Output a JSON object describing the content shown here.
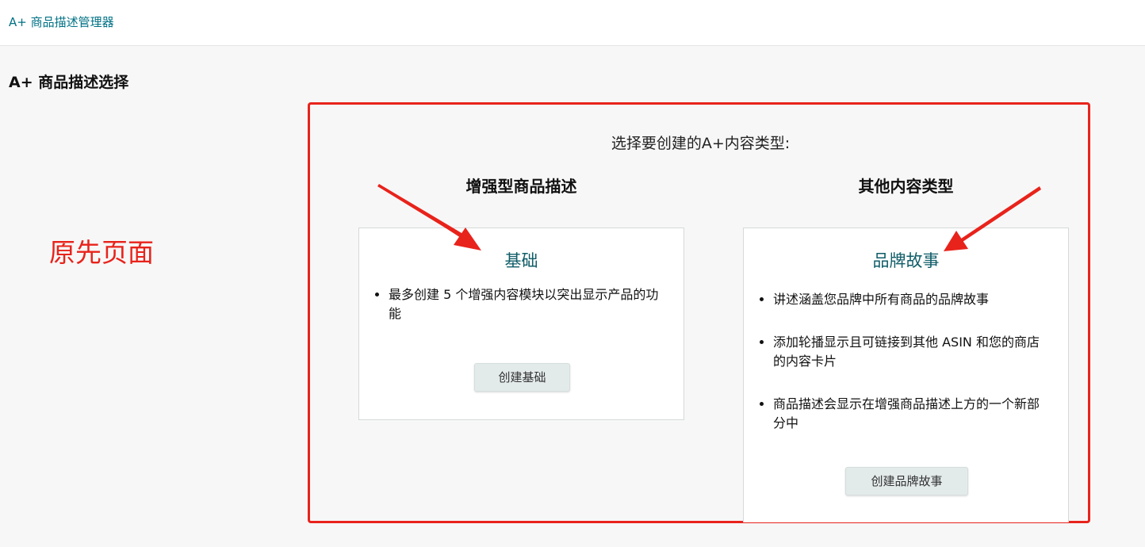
{
  "header": {
    "breadcrumb": "A+ 商品描述管理器"
  },
  "page": {
    "title": "A+ 商品描述选择"
  },
  "annotation": {
    "label": "原先页面",
    "color": "#e8231b"
  },
  "selection": {
    "prompt": "选择要创建的A+内容类型:",
    "columns": [
      {
        "heading": "增强型商品描述",
        "card": {
          "title": "基础",
          "bullets": [
            "最多创建 5 个增强内容模块以突出显示产品的功能"
          ],
          "button_label": "创建基础"
        }
      },
      {
        "heading": "其他内容类型",
        "card": {
          "title": "品牌故事",
          "bullets": [
            "讲述涵盖您品牌中所有商品的品牌故事",
            "添加轮播显示且可链接到其他 ASIN 和您的商店的内容卡片",
            "商品描述会显示在增强商品描述上方的一个新部分中"
          ],
          "button_label": "创建品牌故事"
        }
      }
    ]
  },
  "colors": {
    "link": "#007185",
    "card_title": "#0f5d68",
    "annotation_red": "#e8231b"
  },
  "icons": [
    "arrow-left-icon",
    "arrow-right-icon"
  ]
}
